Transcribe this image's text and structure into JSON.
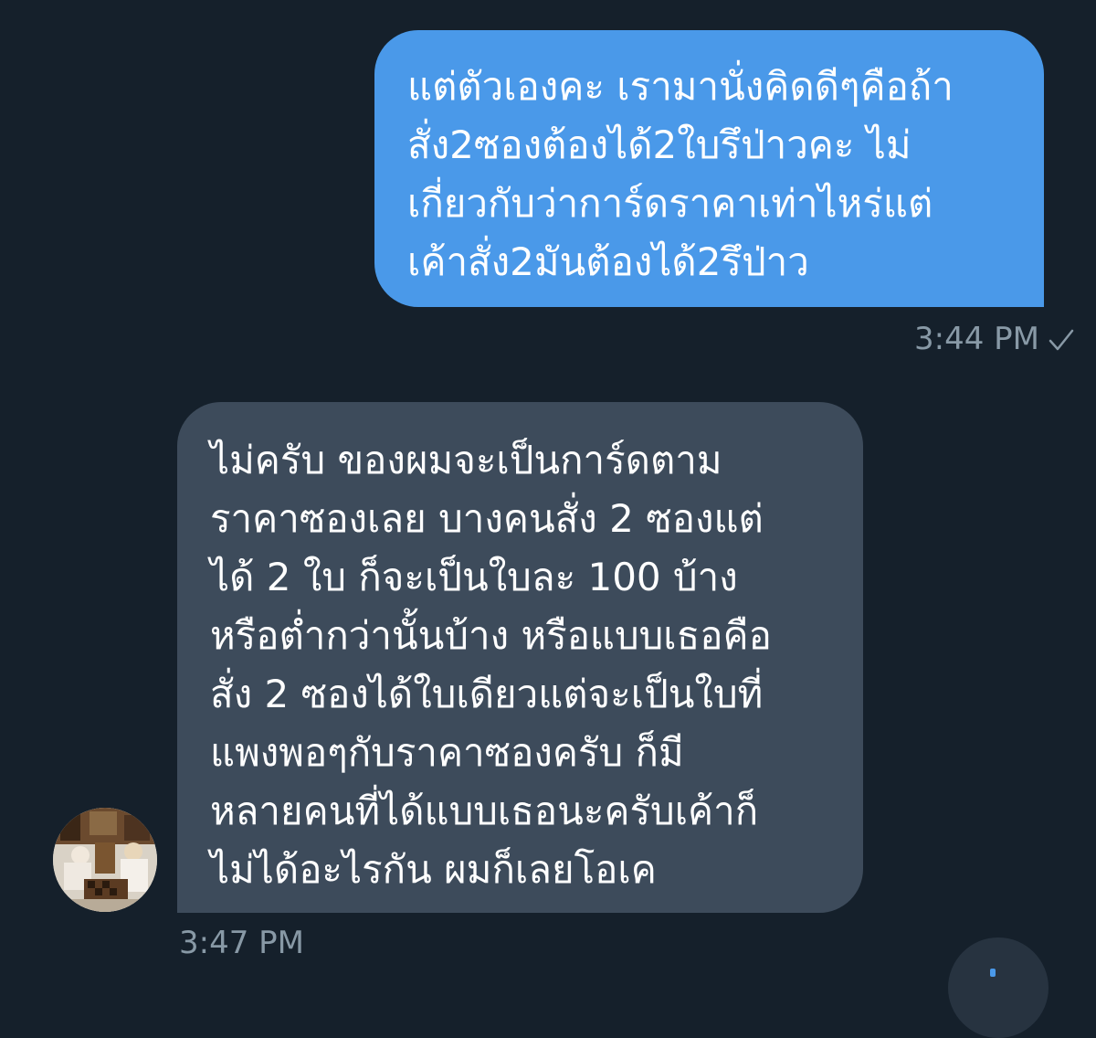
{
  "conversation": {
    "messages": [
      {
        "direction": "sent",
        "text": "แต่ตัวเองคะ เรามานั่งคิดดีๆคือถ้า\nสั่ง2ซองต้องได้2ใบรึป่าวคะ ไม่\nเกี่ยวกับว่าการ์ดราคาเท่าไหร่แต่\nเค้าสั่ง2มันต้องได้2รึป่าว",
        "time": "3:44 PM",
        "status_icon": "checkmark-icon"
      },
      {
        "direction": "received",
        "text": "ไม่ครับ ของผมจะเป็นการ์ดตาม\nราคาซองเลย บางคนสั่ง 2 ซองแต่\nได้ 2 ใบ ก็จะเป็นใบละ 100 บ้าง\nหรือต่ำกว่านั้นบ้าง หรือแบบเธอคือ\nสั่ง 2 ซองได้ใบเดียวแต่จะเป็นใบที่\nแพงพอๆกับราคาซองครับ ก็มี\nหลายคนที่ได้แบบเธอนะครับเค้าก็\nไม่ได้อะไรกัน ผมก็เลยโอเค",
        "time": "3:47 PM",
        "avatar_icon": "user-avatar-photo"
      }
    ]
  },
  "theme": {
    "background": "#15202b",
    "sent_bubble": "#4a99e9",
    "received_bubble": "#3d4b5b",
    "meta_text": "#8899a6",
    "message_text": "#ffffff"
  }
}
